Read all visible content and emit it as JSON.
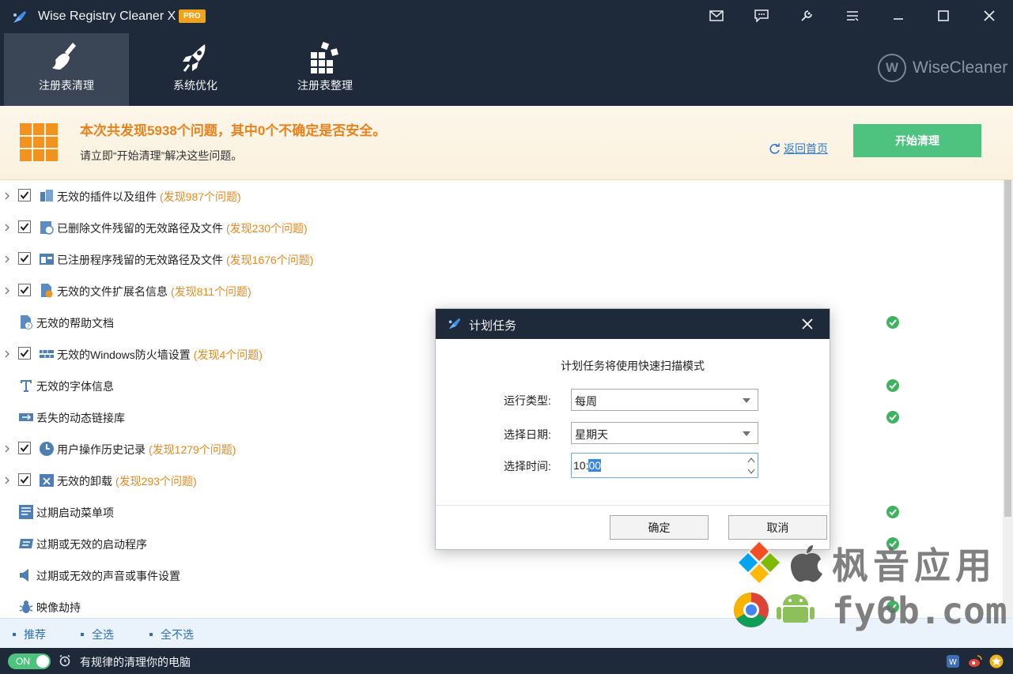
{
  "window": {
    "title": "Wise Registry Cleaner X",
    "badge": "PRO"
  },
  "nav": {
    "tabs": [
      {
        "label": "注册表清理",
        "icon": "broom-icon",
        "active": true
      },
      {
        "label": "系统优化",
        "icon": "rocket-icon",
        "active": false
      },
      {
        "label": "注册表整理",
        "icon": "blocks-icon",
        "active": false
      }
    ],
    "brand": "WiseCleaner",
    "brand_letter": "W"
  },
  "summary": {
    "title": "本次共发现5938个问题，其中0个不确定是否安全。",
    "subtitle": "请立即“开始清理”解决这些问题。",
    "back_home": "返回首页",
    "start_button": "开始清理"
  },
  "issues": [
    {
      "label": "无效的插件以及组件",
      "count": "(发现987个问题)",
      "checked": true
    },
    {
      "label": "已删除文件残留的无效路径及文件",
      "count": "(发现230个问题)",
      "checked": true
    },
    {
      "label": "已注册程序残留的无效路径及文件",
      "count": "(发现1676个问题)",
      "checked": true
    },
    {
      "label": "无效的文件扩展名信息",
      "count": "(发现811个问题)",
      "checked": true
    },
    {
      "label": "无效的帮助文档",
      "count": "",
      "checked": false
    },
    {
      "label": "无效的Windows防火墙设置",
      "count": "(发现4个问题)",
      "checked": true
    },
    {
      "label": "无效的字体信息",
      "count": "",
      "checked": false
    },
    {
      "label": "丢失的动态链接库",
      "count": "",
      "checked": false
    },
    {
      "label": "用户操作历史记录",
      "count": "(发现1279个问题)",
      "checked": true
    },
    {
      "label": "无效的卸载",
      "count": "(发现293个问题)",
      "checked": true
    },
    {
      "label": "过期启动菜单项",
      "count": "",
      "checked": false
    },
    {
      "label": "过期或无效的启动程序",
      "count": "",
      "checked": false
    },
    {
      "label": "过期或无效的声音或事件设置",
      "count": "",
      "checked": false
    },
    {
      "label": "映像劫持",
      "count": "",
      "checked": false
    }
  ],
  "selectbar": {
    "recommend": "推荐",
    "select_all": "全选",
    "select_none": "全不选"
  },
  "status": {
    "toggle": "ON",
    "text": "有规律的清理你的电脑"
  },
  "dialog": {
    "title": "计划任务",
    "note": "计划任务将使用快速扫描模式",
    "run_type_label": "运行类型:",
    "run_type_value": "每周",
    "date_label": "选择日期:",
    "date_value": "星期天",
    "time_label": "选择时间:",
    "time_hour": "10:",
    "time_minute": "00",
    "ok": "确定",
    "cancel": "取消"
  },
  "watermark": {
    "line1": "枫音应用",
    "line2": "fy6b.com"
  },
  "colors": {
    "header_bg": "#1e2a3a",
    "accent_orange": "#e8821c",
    "accent_green": "#4ec27f",
    "link_blue": "#2d7ad6"
  }
}
